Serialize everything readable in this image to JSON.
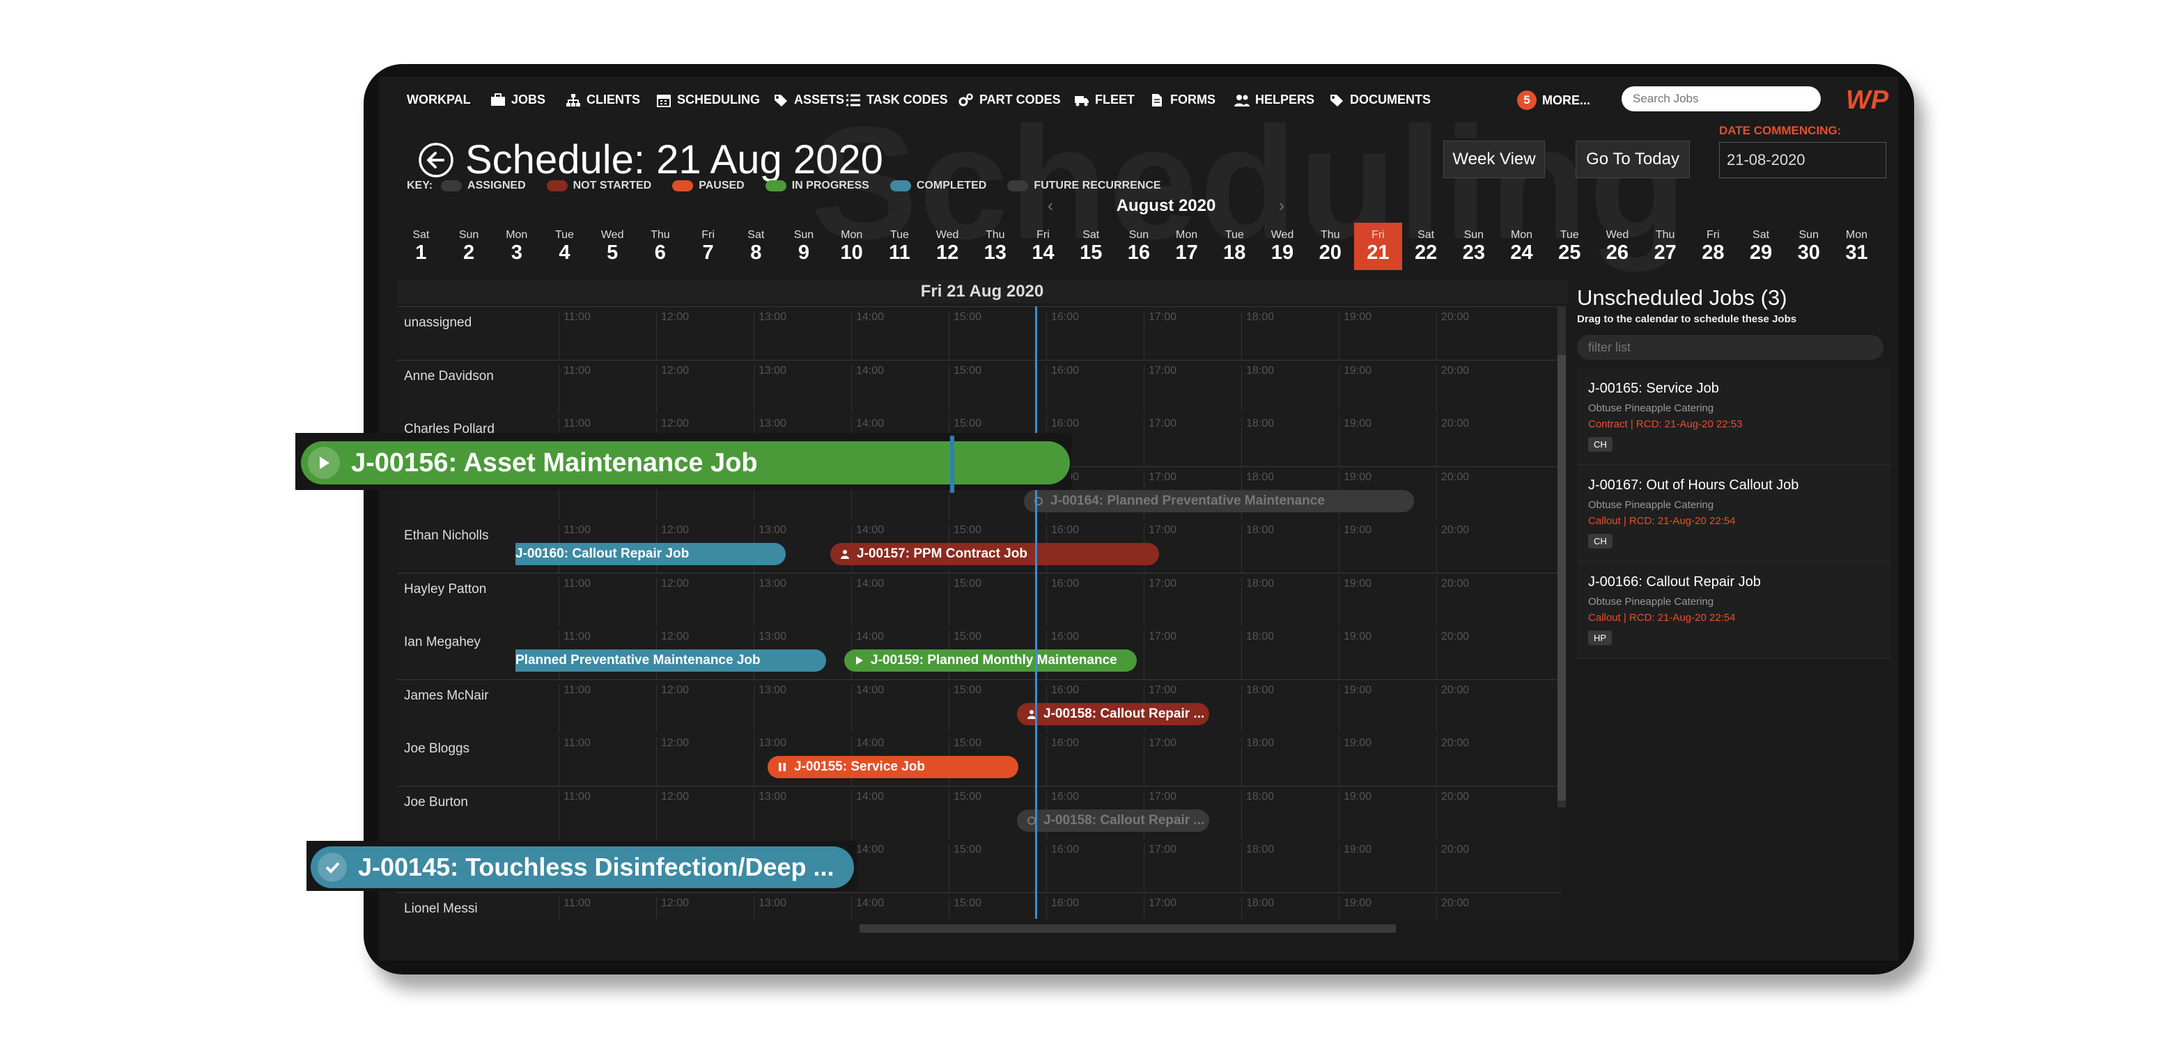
{
  "nav": {
    "brand": "WORKPAL",
    "items": [
      {
        "label": "JOBS",
        "icon": "briefcase-icon"
      },
      {
        "label": "CLIENTS",
        "icon": "sitemap-icon"
      },
      {
        "label": "SCHEDULING",
        "icon": "calendar-icon"
      },
      {
        "label": "ASSETS",
        "icon": "tag-icon"
      },
      {
        "label": "TASK CODES",
        "icon": "list-icon"
      },
      {
        "label": "PART CODES",
        "icon": "cogs-icon"
      },
      {
        "label": "FLEET",
        "icon": "truck-icon"
      },
      {
        "label": "FORMS",
        "icon": "document-icon"
      },
      {
        "label": "HELPERS",
        "icon": "users-icon"
      },
      {
        "label": "DOCUMENTS",
        "icon": "tag-icon"
      }
    ],
    "more_count": "5",
    "more_label": "MORE...",
    "search_placeholder": "Search Jobs",
    "logo_text": "WP"
  },
  "header": {
    "watermark": "Scheduling",
    "title": "Schedule: 21 Aug 2020",
    "week_view": "Week View",
    "go_today": "Go To Today",
    "date_label": "DATE COMMENCING:",
    "date_value": "21-08-2020"
  },
  "key": {
    "label": "KEY:",
    "items": [
      {
        "label": "ASSIGNED",
        "color": "#3a3a3b"
      },
      {
        "label": "NOT STARTED",
        "color": "#8b2a1f"
      },
      {
        "label": "PAUSED",
        "color": "#e24f27"
      },
      {
        "label": "IN PROGRESS",
        "color": "#4a9a3a"
      },
      {
        "label": "COMPLETED",
        "color": "#3d8aa3"
      },
      {
        "label": "FUTURE RECURRENCE",
        "color": "#3a3a3b"
      }
    ]
  },
  "calendar": {
    "month": "August 2020",
    "prev": "‹",
    "next": "›",
    "days": [
      {
        "n": "Sat",
        "d": "1"
      },
      {
        "n": "Sun",
        "d": "2"
      },
      {
        "n": "Mon",
        "d": "3"
      },
      {
        "n": "Tue",
        "d": "4"
      },
      {
        "n": "Wed",
        "d": "5"
      },
      {
        "n": "Thu",
        "d": "6"
      },
      {
        "n": "Fri",
        "d": "7"
      },
      {
        "n": "Sat",
        "d": "8"
      },
      {
        "n": "Sun",
        "d": "9"
      },
      {
        "n": "Mon",
        "d": "10"
      },
      {
        "n": "Tue",
        "d": "11"
      },
      {
        "n": "Wed",
        "d": "12"
      },
      {
        "n": "Thu",
        "d": "13"
      },
      {
        "n": "Fri",
        "d": "14"
      },
      {
        "n": "Sat",
        "d": "15"
      },
      {
        "n": "Sun",
        "d": "16"
      },
      {
        "n": "Mon",
        "d": "17"
      },
      {
        "n": "Tue",
        "d": "18"
      },
      {
        "n": "Wed",
        "d": "19"
      },
      {
        "n": "Thu",
        "d": "20"
      },
      {
        "n": "Fri",
        "d": "21"
      },
      {
        "n": "Sat",
        "d": "22"
      },
      {
        "n": "Sun",
        "d": "23"
      },
      {
        "n": "Mon",
        "d": "24"
      },
      {
        "n": "Tue",
        "d": "25"
      },
      {
        "n": "Wed",
        "d": "26"
      },
      {
        "n": "Thu",
        "d": "27"
      },
      {
        "n": "Fri",
        "d": "28"
      },
      {
        "n": "Sat",
        "d": "29"
      },
      {
        "n": "Sun",
        "d": "30"
      },
      {
        "n": "Mon",
        "d": "31"
      }
    ],
    "active_day": "21"
  },
  "schedule": {
    "date_title": "Fri 21 Aug 2020",
    "hours": [
      "11:00",
      "12:00",
      "13:00",
      "14:00",
      "15:00",
      "16:00",
      "17:00",
      "18:00",
      "19:00",
      "20:00"
    ],
    "rows": [
      "unassigned",
      "Anne Davidson",
      "Charles Pollard",
      "",
      "Ethan Nicholls",
      "Hayley Patton",
      "Ian Megahey",
      "James McNair",
      "Joe Bloggs",
      "Joe Burton",
      "",
      "Lionel Messi"
    ],
    "jobs": [
      {
        "label": "J-00164: Planned Preventative Maintenance",
        "status": "gray",
        "row": 3
      },
      {
        "label": "J-00160: Callout Repair Job",
        "status": "blue",
        "row": 4
      },
      {
        "label": "J-00157: PPM Contract Job",
        "status": "red",
        "row": 4
      },
      {
        "label": "Planned Preventative Maintenance Job",
        "status": "blue",
        "row": 6
      },
      {
        "label": "J-00159: Planned Monthly Maintenance",
        "status": "green",
        "row": 6
      },
      {
        "label": "J-00158: Callout Repair ...",
        "status": "red",
        "row": 7
      },
      {
        "label": "J-00155: Service Job",
        "status": "orange",
        "row": 8
      },
      {
        "label": "J-00158: Callout Repair ...",
        "status": "gray",
        "row": 9
      }
    ],
    "float_jobs": [
      {
        "label": "J-00156: Asset Maintenance Job",
        "status": "green"
      },
      {
        "label": "J-00145: Touchless Disinfection/Deep ...",
        "status": "blue"
      }
    ]
  },
  "unscheduled": {
    "title": "Unscheduled Jobs (3)",
    "subtitle": "Drag to the calendar to schedule these Jobs",
    "filter_placeholder": "filter list",
    "jobs": [
      {
        "title": "J-00165: Service Job",
        "client": "Obtuse Pineapple Catering",
        "detail": "Contract | RCD: 21-Aug-20 22:53",
        "tag": "CH"
      },
      {
        "title": "J-00167: Out of Hours Callout Job",
        "client": "Obtuse Pineapple Catering",
        "detail": "Callout | RCD: 21-Aug-20 22:54",
        "tag": "CH"
      },
      {
        "title": "J-00166: Callout Repair Job",
        "client": "Obtuse Pineapple Catering",
        "detail": "Callout | RCD: 21-Aug-20 22:54",
        "tag": "HP"
      }
    ]
  }
}
